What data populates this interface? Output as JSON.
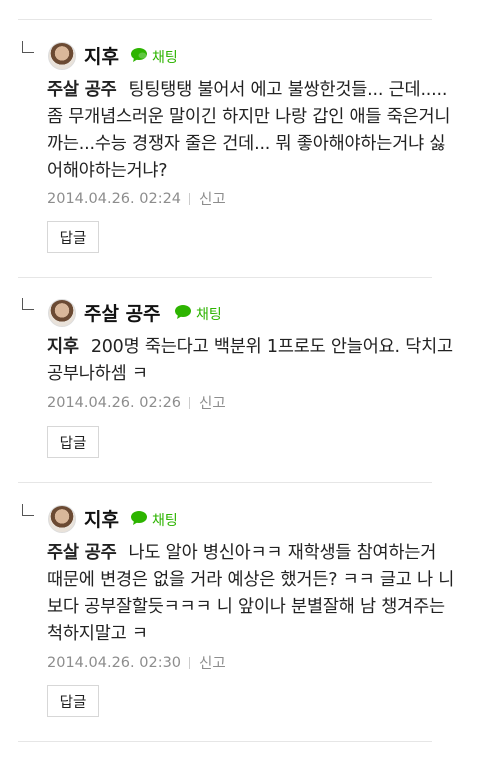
{
  "chat_label": "채팅",
  "report_label": "신고",
  "reply_button_label": "답글",
  "comments": [
    {
      "author": "지후",
      "target": "주살 공주",
      "text": "팅팅탱탱 불어서 에고 불쌍한것들... 근데.....좀 무개념스러운 말이긴 하지만 나랑 갑인 애들 죽은거니까는...수능 경쟁자 줄은 건데... 뭐 좋아해야하는거냐 싫어해야하는거냐?",
      "date": "2014.04.26. 02:24"
    },
    {
      "author": "주살 공주",
      "target": "지후",
      "text": "200명 죽는다고 백분위 1프로도 안늘어요. 닥치고 공부나하셈 ㅋ",
      "date": "2014.04.26. 02:26"
    },
    {
      "author": "지후",
      "target": "주살 공주",
      "text": "나도 알아 병신아ㅋㅋ 재학생들 참여하는거 때문에 변경은 없을 거라 예상은 했거든? ㅋㅋ 글고 나 니보다 공부잘할듯ㅋㅋㅋ 니 앞이나 분별잘해 남 챙겨주는 척하지말고 ㅋ",
      "date": "2014.04.26. 02:30"
    }
  ]
}
